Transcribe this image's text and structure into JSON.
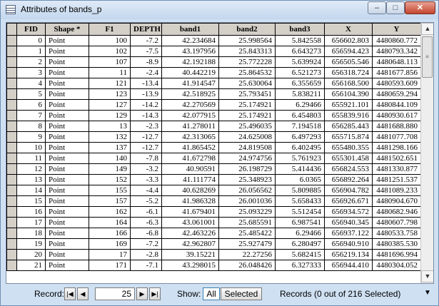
{
  "window": {
    "title": "Attributes of bands_p",
    "minimize": "–",
    "maximize": "□",
    "close": "✕",
    "table_icon": "table-icon"
  },
  "table": {
    "columns": [
      "FID",
      "Shape *",
      "F1",
      "DEPTH",
      "band1",
      "band2",
      "band3",
      "X",
      "Y"
    ],
    "rows": [
      [
        "0",
        "Point",
        "100",
        "-7.2",
        "42.234684",
        "25.998564",
        "5.842558",
        "656602.803",
        "4480860.772"
      ],
      [
        "1",
        "Point",
        "102",
        "-7.5",
        "43.197956",
        "25.843313",
        "6.643273",
        "656594.423",
        "4480793.342"
      ],
      [
        "2",
        "Point",
        "107",
        "-8.9",
        "42.192188",
        "25.772228",
        "5.639924",
        "656505.546",
        "4480648.113"
      ],
      [
        "3",
        "Point",
        "11",
        "-2.4",
        "40.442219",
        "25.864532",
        "6.521273",
        "656318.724",
        "4481677.856"
      ],
      [
        "4",
        "Point",
        "121",
        "-13.4",
        "41.914547",
        "25.630064",
        "6.355659",
        "656168.500",
        "4480593.609"
      ],
      [
        "5",
        "Point",
        "123",
        "-13.9",
        "42.518925",
        "25.793451",
        "5.838211",
        "656104.390",
        "4480659.294"
      ],
      [
        "6",
        "Point",
        "127",
        "-14.2",
        "42.270569",
        "25.174921",
        "6.29466",
        "655921.101",
        "4480844.109"
      ],
      [
        "7",
        "Point",
        "129",
        "-14.3",
        "42.077915",
        "25.174921",
        "6.454803",
        "655839.916",
        "4480930.617"
      ],
      [
        "8",
        "Point",
        "13",
        "-2.3",
        "41.278011",
        "25.496035",
        "7.194518",
        "656285.443",
        "4481688.880"
      ],
      [
        "9",
        "Point",
        "132",
        "-12.7",
        "42.313065",
        "24.625008",
        "6.497293",
        "655715.874",
        "4481077.708"
      ],
      [
        "10",
        "Point",
        "137",
        "-12.7",
        "41.865452",
        "24.819508",
        "6.402495",
        "655480.355",
        "4481298.166"
      ],
      [
        "11",
        "Point",
        "140",
        "-7.8",
        "41.672798",
        "24.974756",
        "5.761923",
        "655301.458",
        "4481502.651"
      ],
      [
        "12",
        "Point",
        "149",
        "-3.2",
        "40.90591",
        "26.198729",
        "5.414436",
        "656824.553",
        "4481330.877"
      ],
      [
        "13",
        "Point",
        "152",
        "-3.3",
        "41.111774",
        "25.348923",
        "6.0365",
        "656892.264",
        "4481251.537"
      ],
      [
        "14",
        "Point",
        "155",
        "-4.4",
        "40.628269",
        "26.056562",
        "5.809885",
        "656904.782",
        "4481089.233"
      ],
      [
        "15",
        "Point",
        "157",
        "-5.2",
        "41.986328",
        "26.001036",
        "5.658433",
        "656926.671",
        "4480904.670"
      ],
      [
        "16",
        "Point",
        "162",
        "-6.1",
        "41.679401",
        "25.093229",
        "5.512454",
        "656934.572",
        "4480682.946"
      ],
      [
        "17",
        "Point",
        "164",
        "-6.3",
        "43.061001",
        "25.685591",
        "6.987541",
        "656940.345",
        "4480607.798"
      ],
      [
        "18",
        "Point",
        "166",
        "-6.8",
        "42.463226",
        "25.485422",
        "6.29466",
        "656937.122",
        "4480533.758"
      ],
      [
        "19",
        "Point",
        "169",
        "-7.2",
        "42.962807",
        "25.927479",
        "6.280497",
        "656940.910",
        "4480385.530"
      ],
      [
        "20",
        "Point",
        "17",
        "-2.8",
        "39.15221",
        "22.27256",
        "5.682415",
        "656219.134",
        "4481696.994"
      ],
      [
        "21",
        "Point",
        "171",
        "-7.1",
        "43.298015",
        "26.048426",
        "6.327333",
        "656944.410",
        "4480304.052"
      ]
    ]
  },
  "footer": {
    "record_label": "Record:",
    "record_value": "25",
    "show_label": "Show:",
    "all_label": "All",
    "selected_label": "Selected",
    "records_status": "Records (0 out of 216 Selected)",
    "first": "|◀",
    "prev": "◀",
    "next": "▶",
    "last": "▶|",
    "options": "▼"
  },
  "colors": {
    "titlebar": "#c3d7ee",
    "header": "#d4d0c8",
    "close": "#c3452e"
  }
}
